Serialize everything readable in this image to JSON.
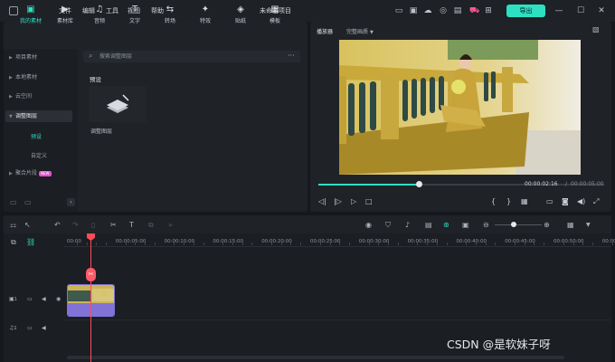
{
  "menu": {
    "file": "文件",
    "edit": "编辑",
    "tools": "工具",
    "view": "视图",
    "help": "帮助"
  },
  "project_title": "未命名项目",
  "export_label": "导出",
  "toolbar": [
    {
      "label": "我的素材",
      "icon": "folder-media-icon"
    },
    {
      "label": "素材库",
      "icon": "play-library-icon"
    },
    {
      "label": "音频",
      "icon": "music-note-icon"
    },
    {
      "label": "文字",
      "icon": "text-t-icon"
    },
    {
      "label": "转场",
      "icon": "transition-icon"
    },
    {
      "label": "特效",
      "icon": "sparkle-effect-icon"
    },
    {
      "label": "贴纸",
      "icon": "sticker-icon"
    },
    {
      "label": "模板",
      "icon": "template-icon"
    }
  ],
  "sidebar": {
    "items": [
      "项目素材",
      "本地素材",
      "云空间",
      "调整图层"
    ],
    "sub_items": [
      "预设",
      "自定义"
    ],
    "merged": "聚合片段",
    "new_badge": "NEW"
  },
  "search": {
    "placeholder": "搜索调整图层"
  },
  "preset_section": {
    "title": "预设",
    "item_label": "调整图层"
  },
  "player": {
    "label": "播放器",
    "quality": "完整画质",
    "current_time": "00:00:02:16",
    "separator": "/",
    "total_time": "00:00:05:00"
  },
  "timeline": {
    "ticks": [
      "00:00",
      "00:00:05:00",
      "00:00:10:00",
      "00:00:15:00",
      "00:00:20:00",
      "00:00:25:00",
      "00:00:30:00",
      "00:00:35:00",
      "00:00:40:00",
      "00:00:45:00",
      "00:00:50:00",
      "00:00:55:0"
    ],
    "video_track": "1",
    "audio_track": "1"
  },
  "watermark": "CSDN @是软妹子呀",
  "colors": {
    "accent": "#2de0c2",
    "playhead": "#ff4a5a",
    "badge": "#e34fd1",
    "clip_border": "#7f74d8"
  }
}
